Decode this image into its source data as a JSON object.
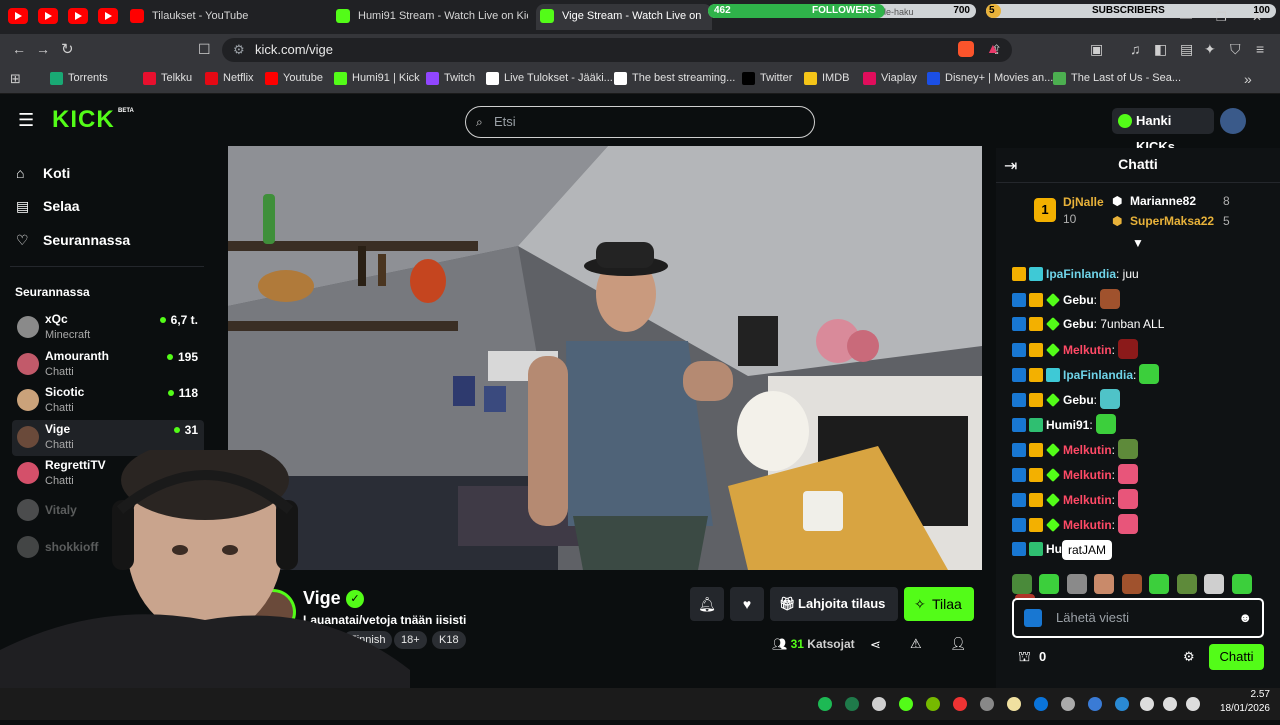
{
  "browser": {
    "tabs": [
      {
        "label": "Tilaukset - YouTube",
        "favicon": "youtube-icon"
      },
      {
        "label": "Humi91 Stream - Watch Live on Kick",
        "favicon": "kick-icon"
      },
      {
        "label": "Vige Stream - Watch Live on",
        "favicon": "kick-icon",
        "active": true
      }
    ],
    "url": "kick.com/vige",
    "overlay": {
      "followers_label": "FOLLOWERS",
      "followers_current": "462",
      "followers_goal": "700",
      "followers_progress": 0.66,
      "subscribers_label": "SUBSCRIBERS",
      "subscribers_current": "5",
      "subscribers_goal": "100",
      "subscribers_progress": 0.05,
      "hidden_tab_text": "le-haku"
    },
    "bookmarks": [
      {
        "label": "Torrents",
        "icon_color": "#19a974"
      },
      {
        "label": "Telkku",
        "icon_color": "#e8102e"
      },
      {
        "label": "Netflix",
        "icon_color": "#e50914"
      },
      {
        "label": "Youtube",
        "icon_color": "#ff0000"
      },
      {
        "label": "Humi91 | Kick",
        "icon_color": "#53fc18"
      },
      {
        "label": "Twitch",
        "icon_color": "#9146ff"
      },
      {
        "label": "Live Tulokset - Jääki...",
        "icon_color": "#ffffff"
      },
      {
        "label": "The best streaming...",
        "icon_color": "#ffffff"
      },
      {
        "label": "Twitter",
        "icon_color": "#000000"
      },
      {
        "label": "IMDB",
        "icon_color": "#f5c518"
      },
      {
        "label": "Viaplay",
        "icon_color": "#e10d5c"
      },
      {
        "label": "Disney+ | Movies an...",
        "icon_color": "#1b4fe6"
      },
      {
        "label": "The Last of Us - Sea...",
        "icon_color": "#4caf50"
      }
    ]
  },
  "kick": {
    "logo": "KICK",
    "logo_badge": "BETA",
    "search_placeholder": "Etsi",
    "get_kicks": "Hanki KICKs",
    "nav": [
      {
        "label": "Koti",
        "icon": "home-icon"
      },
      {
        "label": "Selaa",
        "icon": "browse-icon"
      },
      {
        "label": "Seurannassa",
        "icon": "heart-icon"
      }
    ],
    "following_title": "Seurannassa",
    "following": [
      {
        "name": "xQc",
        "sub": "Minecraft",
        "count": "6,7 t."
      },
      {
        "name": "Amouranth",
        "sub": "Chatti",
        "count": "195"
      },
      {
        "name": "Sicotic",
        "sub": "Chatti",
        "count": "118"
      },
      {
        "name": "Vige",
        "sub": "Chatti",
        "count": "31",
        "active": true
      },
      {
        "name": "RegrettiTV",
        "sub": "Chatti",
        "count": ""
      },
      {
        "name": "Vitaly",
        "sub": "",
        "count": "",
        "offline": true
      },
      {
        "name": "shokkioff",
        "sub": "",
        "count": "",
        "offline": true
      }
    ],
    "channel": {
      "name": "Vige",
      "title": "Lauanatai/vetoja tnään iisisti",
      "category": "tti",
      "tags": [
        "Finnish",
        "18+",
        "K18"
      ],
      "viewers_count": "31",
      "viewers_label": "Katsojat",
      "gift_sub": "Lahjoita tilaus",
      "subscribe": "Tilaa"
    },
    "chat": {
      "title": "Chatti",
      "top_gifters": [
        {
          "rank": "1",
          "name": "DjNalle",
          "count": "10"
        },
        {
          "name": "Marianne82",
          "count": "8"
        },
        {
          "name": "SuperMaksa22",
          "count": "5"
        }
      ],
      "messages": [
        {
          "user": "IpaFinlandia",
          "text": ": juu",
          "color": "teal",
          "badges": [
            "gold",
            "teal"
          ]
        },
        {
          "user": "Gebu",
          "text": ":",
          "color": "white",
          "badges": [
            "blue",
            "gold",
            "green"
          ],
          "emote": "#a0522d"
        },
        {
          "user": "Gebu",
          "text": ": 7unban ALL",
          "color": "white",
          "badges": [
            "blue",
            "gold",
            "green"
          ]
        },
        {
          "user": "Melkutin",
          "text": ":",
          "color": "red",
          "badges": [
            "blue",
            "gold",
            "green"
          ],
          "emote": "#8b1a1a"
        },
        {
          "user": "IpaFinlandia",
          "text": ":",
          "color": "teal",
          "badges": [
            "blue",
            "gold",
            "teal"
          ],
          "emote": "#3ccf3c"
        },
        {
          "user": "Gebu",
          "text": ":",
          "color": "white",
          "badges": [
            "blue",
            "gold",
            "green"
          ],
          "emote": "#4fc3c8"
        },
        {
          "user": "Humi91",
          "text": ":",
          "color": "white",
          "badges": [
            "blue",
            "sub"
          ],
          "emote": "#3ccf3c"
        },
        {
          "user": "Melkutin",
          "text": ":",
          "color": "red",
          "badges": [
            "blue",
            "gold",
            "green"
          ],
          "emote": "#5e8a3a"
        },
        {
          "user": "Melkutin",
          "text": ":",
          "color": "red",
          "badges": [
            "blue",
            "gold",
            "green"
          ],
          "emote": "#e8557a"
        },
        {
          "user": "Melkutin",
          "text": ":",
          "color": "red",
          "badges": [
            "blue",
            "gold",
            "green"
          ],
          "emote": "#e8557a"
        },
        {
          "user": "Melkutin",
          "text": ":",
          "color": "red",
          "badges": [
            "blue",
            "gold",
            "green"
          ],
          "emote": "#e8557a"
        },
        {
          "user": "Hu",
          "text": "",
          "color": "white",
          "badges": [
            "blue",
            "sub"
          ]
        }
      ],
      "tooltip": "ratJAM",
      "input_placeholder": "Lähetä viesti",
      "points": "0",
      "send": "Chatti"
    }
  },
  "taskbar": {
    "time": "2.57",
    "date": "18/01/2026"
  },
  "colors": {
    "kick_green": "#53fc18",
    "bg": "#0b0e0f",
    "chat_bg": "#0f1214"
  }
}
